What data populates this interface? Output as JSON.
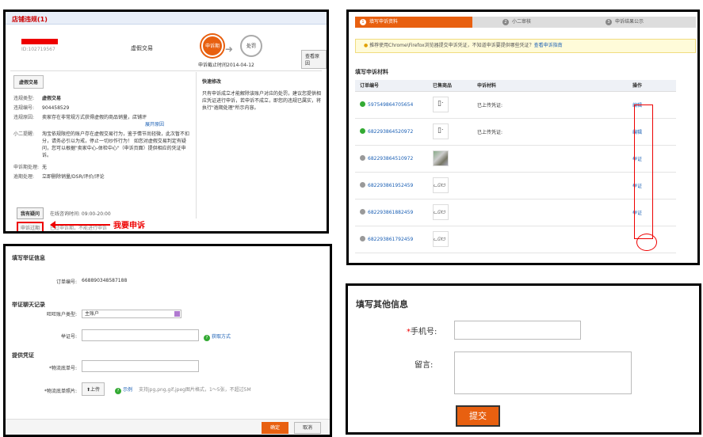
{
  "panel1": {
    "header": "店铺违规(1)",
    "id_text": "ID:102719567",
    "type_label": "虚假交易",
    "step1": "申诉期",
    "step2": "处罚",
    "deadline": "申诉截止时间2014-04-12",
    "view_btn": "查看原因",
    "tab": "虚假交易",
    "rows": [
      {
        "k": "违规类型:",
        "v": "虚假交易"
      },
      {
        "k": "违规编号:",
        "v": "904458529"
      },
      {
        "k": "违规原因:",
        "v": "卖家存在非常规方式获得虚假的商品销量，店铺评"
      },
      {
        "k": "小二提醒:",
        "v": "淘宝依规限控的账户存在虚假交易行为，鉴于情节尚轻微，此次暂不扣分，请务必引以为戒，停止一切炒作行为！ 如您对虚假交易判定有疑问，您可以根据\"卖家中心-体检中心\"（申诉页面）提供相应的凭证申诉。"
      },
      {
        "k": "申诉期处理:",
        "v": "无"
      },
      {
        "k": "逾期处理:",
        "v": "立即删除销量/DSR/评价/评论"
      }
    ],
    "expand_link": "展开原因",
    "right_title": "快速修改",
    "right_text": "只有申诉成立才能解除该账户对应的处罚，建议您提供相应凭证进行申诉，若申诉不成立，即您的违规已属实，将执行\"逾期处理\"所示内容。",
    "ask_btn": "我有疑问",
    "hours": "在线咨询时间: 09:00-20:00",
    "appeal_btn": "申诉过期",
    "note": "已过申诉期，不能进行申诉",
    "callout": "我要申诉"
  },
  "panel2": {
    "steps": [
      "填写申诉资料",
      "小二审核",
      "申诉结果公示"
    ],
    "tip_text": "推荐使用Chrome\\Firefox浏览器提交申诉凭证，不知道申诉要提供哪些凭证？",
    "tip_link": "查看申诉指南",
    "section": "填写申诉材料",
    "columns": [
      "订单编号",
      "已售商品",
      "申诉材料",
      "操作"
    ],
    "rows": [
      {
        "order": "597549864705654",
        "status": "green",
        "thumb": "dev",
        "material": "已上传凭证:",
        "op": "编辑"
      },
      {
        "order": "682293864520972",
        "status": "green",
        "thumb": "dev",
        "material": "已上传凭证:",
        "op": "编辑"
      },
      {
        "order": "682293864510972",
        "status": "grey",
        "thumb": "photo",
        "material": "",
        "op": "举证"
      },
      {
        "order": "682293861952459",
        "status": "grey",
        "thumb": "cat",
        "material": "",
        "op": "举证"
      },
      {
        "order": "682293861882459",
        "status": "grey",
        "thumb": "cat",
        "material": "",
        "op": "举证"
      },
      {
        "order": "682293861792459",
        "status": "grey",
        "thumb": "cat",
        "material": "",
        "op": ""
      }
    ]
  },
  "panel3": {
    "title": "填写举证信息",
    "order_label": "订单编号:",
    "order_value": "668890348587188",
    "chat_section": "举证聊天记录",
    "acct_label": "旺旺账户类型:",
    "acct_value": "主账户",
    "evidence_label": "举证号:",
    "get_method": "获取方式",
    "proof_section": "提供凭证",
    "track_label": "*物流底单号:",
    "photo_label": "*物流底单照片:",
    "upload_btn": "上传",
    "example": "示例",
    "format_text": "支持jpg,png,gif,jpeg图片格式，1～5张，不超过5M",
    "ok_btn": "确定",
    "cancel_btn": "取消"
  },
  "panel4": {
    "title": "填写其他信息",
    "phone_label": "手机号:",
    "msg_label": "留言:",
    "submit": "提交"
  }
}
